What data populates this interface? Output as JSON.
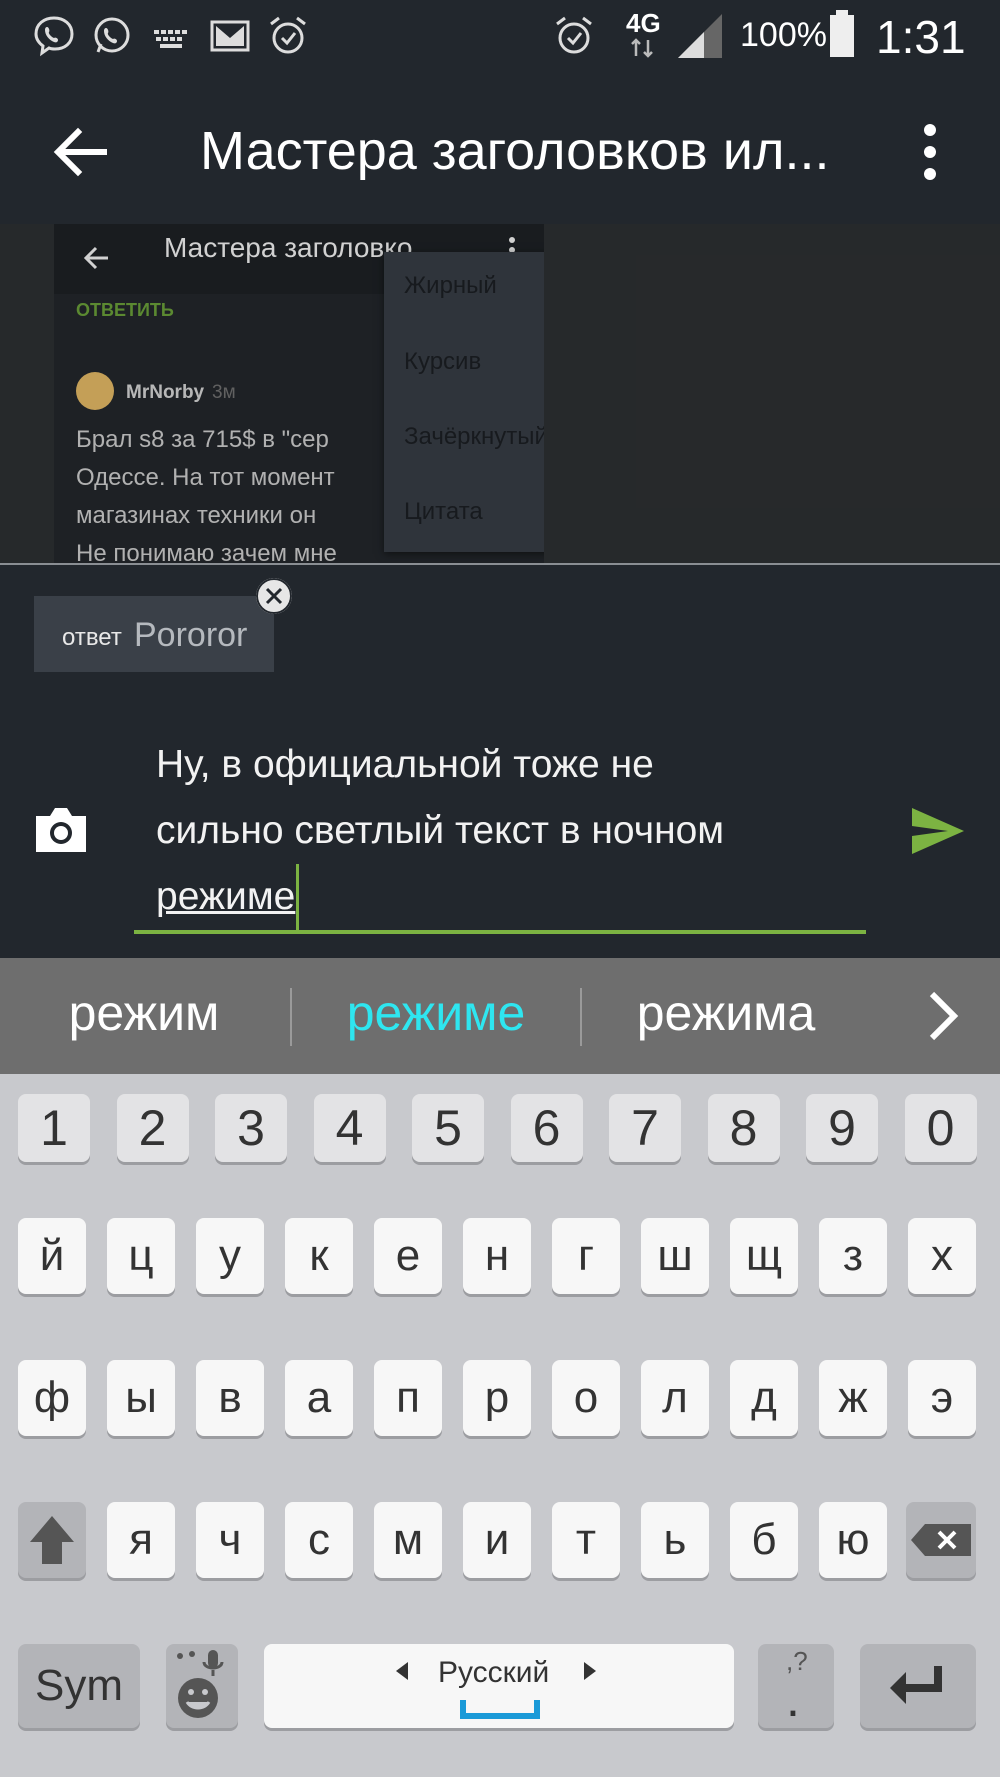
{
  "status_bar": {
    "network": "4G",
    "battery": "100%",
    "time": "1:31",
    "left_icons": [
      "viber-icon",
      "whatsapp-icon",
      "keyboard-icon",
      "mail-icon",
      "alarm-icon"
    ],
    "right_icons": [
      "alarm-icon",
      "signal-icon",
      "battery-icon"
    ]
  },
  "app_bar": {
    "title": "Мастера заголовков ил...",
    "back_icon": "arrow-back-icon",
    "more_icon": "more-vert-icon"
  },
  "preview": {
    "title": "Мастера заголовко",
    "reply_label": "ОТВЕТИТЬ",
    "username": "MrNorby",
    "time": "3м",
    "lines": [
      "Брал s8 за 715$ в \"сер",
      "Одессе. На тот момент",
      "магазинах техники он",
      "Не понимаю зачем мне"
    ],
    "menu_items": [
      "Жирный",
      "Курсив",
      "Зачёркнутый",
      "Цитата"
    ]
  },
  "reply_chip": {
    "prefix": "ответ",
    "user": "Pororor"
  },
  "compose": {
    "lines": [
      "Ну, в официальной тоже не",
      "сильно светлый текст в ночном",
      "режиме"
    ],
    "camera_icon": "camera-icon",
    "send_icon": "send-icon"
  },
  "suggestions": [
    "режим",
    "режиме",
    "режима"
  ],
  "keyboard": {
    "numbers": [
      "1",
      "2",
      "3",
      "4",
      "5",
      "6",
      "7",
      "8",
      "9",
      "0"
    ],
    "row1": [
      "й",
      "ц",
      "у",
      "к",
      "е",
      "н",
      "г",
      "ш",
      "щ",
      "з",
      "х"
    ],
    "row2": [
      "ф",
      "ы",
      "в",
      "а",
      "п",
      "р",
      "о",
      "л",
      "д",
      "ж",
      "э"
    ],
    "row3": [
      "я",
      "ч",
      "с",
      "м",
      "и",
      "т",
      "ь",
      "б",
      "ю"
    ],
    "sym_label": "Sym",
    "language_label": "Русский",
    "period_label": ".",
    "period_hint": ",?"
  },
  "colors": {
    "accent_green": "#7cb342",
    "suggestion_highlight": "#2ee6f0",
    "app_bg": "#22272d"
  }
}
